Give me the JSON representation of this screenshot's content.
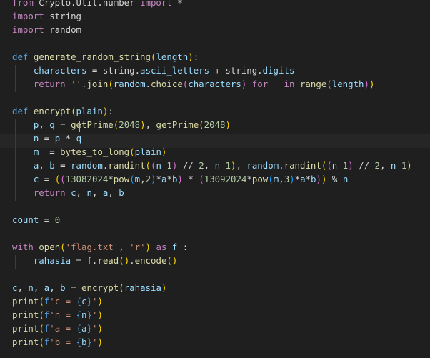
{
  "editor": {
    "language": "python",
    "theme_colors": {
      "background": "#1f1f1f",
      "keyword": "#569cd6",
      "control": "#c586c0",
      "function": "#dcdcaa",
      "string": "#ce9178",
      "number": "#b5cea8",
      "variable": "#9cdcfe",
      "default": "#d4d4d4"
    },
    "lines": [
      {
        "tokens": [
          {
            "t": "from",
            "c": "ctl"
          },
          {
            "t": " Crypto.Util.number ",
            "c": "op"
          },
          {
            "t": "import",
            "c": "ctl"
          },
          {
            "t": " *",
            "c": "op"
          }
        ]
      },
      {
        "tokens": [
          {
            "t": "import",
            "c": "ctl"
          },
          {
            "t": " string",
            "c": "op"
          }
        ]
      },
      {
        "tokens": [
          {
            "t": "import",
            "c": "ctl"
          },
          {
            "t": " random",
            "c": "op"
          }
        ]
      },
      {
        "tokens": []
      },
      {
        "tokens": [
          {
            "t": "def",
            "c": "kw"
          },
          {
            "t": " ",
            "c": "op"
          },
          {
            "t": "generate_random_string",
            "c": "fn"
          },
          {
            "t": "(",
            "c": "pr"
          },
          {
            "t": "length",
            "c": "var"
          },
          {
            "t": ")",
            "c": "pr"
          },
          {
            "t": ":",
            "c": "op"
          }
        ]
      },
      {
        "tokens": [
          {
            "t": "    characters",
            "c": "var"
          },
          {
            "t": " = string.",
            "c": "op"
          },
          {
            "t": "ascii_letters",
            "c": "var"
          },
          {
            "t": " + string.",
            "c": "op"
          },
          {
            "t": "digits",
            "c": "var"
          }
        ]
      },
      {
        "tokens": [
          {
            "t": "    ",
            "c": "op"
          },
          {
            "t": "return",
            "c": "ctl"
          },
          {
            "t": " ",
            "c": "op"
          },
          {
            "t": "''",
            "c": "str"
          },
          {
            "t": ".",
            "c": "op"
          },
          {
            "t": "join",
            "c": "fn"
          },
          {
            "t": "(",
            "c": "pr"
          },
          {
            "t": "random",
            "c": "var"
          },
          {
            "t": ".",
            "c": "op"
          },
          {
            "t": "choice",
            "c": "fn"
          },
          {
            "t": "(",
            "c": "pr2"
          },
          {
            "t": "characters",
            "c": "var"
          },
          {
            "t": ")",
            "c": "pr2"
          },
          {
            "t": " ",
            "c": "op"
          },
          {
            "t": "for",
            "c": "ctl"
          },
          {
            "t": " _ ",
            "c": "op"
          },
          {
            "t": "in",
            "c": "ctl"
          },
          {
            "t": " ",
            "c": "op"
          },
          {
            "t": "range",
            "c": "fn"
          },
          {
            "t": "(",
            "c": "pr2"
          },
          {
            "t": "length",
            "c": "var"
          },
          {
            "t": ")",
            "c": "pr2"
          },
          {
            "t": ")",
            "c": "pr"
          }
        ]
      },
      {
        "tokens": []
      },
      {
        "tokens": [
          {
            "t": "def",
            "c": "kw"
          },
          {
            "t": " ",
            "c": "op"
          },
          {
            "t": "encrypt",
            "c": "fn"
          },
          {
            "t": "(",
            "c": "pr"
          },
          {
            "t": "plain",
            "c": "var"
          },
          {
            "t": ")",
            "c": "pr"
          },
          {
            "t": ":",
            "c": "op"
          }
        ]
      },
      {
        "tokens": [
          {
            "t": "    p",
            "c": "var"
          },
          {
            "t": ", ",
            "c": "op"
          },
          {
            "t": "q",
            "c": "var"
          },
          {
            "t": " = ",
            "c": "op"
          },
          {
            "t": "getPrime",
            "c": "fn"
          },
          {
            "t": "(",
            "c": "pr"
          },
          {
            "t": "2048",
            "c": "num"
          },
          {
            "t": ")",
            "c": "pr"
          },
          {
            "t": ", ",
            "c": "op"
          },
          {
            "t": "getPrime",
            "c": "fn"
          },
          {
            "t": "(",
            "c": "pr"
          },
          {
            "t": "2048",
            "c": "num"
          },
          {
            "t": ")",
            "c": "pr"
          }
        ]
      },
      {
        "tokens": [
          {
            "t": "    n",
            "c": "var"
          },
          {
            "t": " = ",
            "c": "op"
          },
          {
            "t": "p",
            "c": "var"
          },
          {
            "t": " * ",
            "c": "op"
          },
          {
            "t": "q",
            "c": "var"
          }
        ]
      },
      {
        "tokens": [
          {
            "t": "    m",
            "c": "var"
          },
          {
            "t": "  = ",
            "c": "op"
          },
          {
            "t": "bytes_to_long",
            "c": "fn"
          },
          {
            "t": "(",
            "c": "pr"
          },
          {
            "t": "plain",
            "c": "var"
          },
          {
            "t": ")",
            "c": "pr"
          }
        ]
      },
      {
        "tokens": [
          {
            "t": "    a",
            "c": "var"
          },
          {
            "t": ", ",
            "c": "op"
          },
          {
            "t": "b",
            "c": "var"
          },
          {
            "t": " = ",
            "c": "op"
          },
          {
            "t": "random",
            "c": "var"
          },
          {
            "t": ".",
            "c": "op"
          },
          {
            "t": "randint",
            "c": "fn"
          },
          {
            "t": "(",
            "c": "pr"
          },
          {
            "t": "(",
            "c": "pr2"
          },
          {
            "t": "n",
            "c": "var"
          },
          {
            "t": "-",
            "c": "op"
          },
          {
            "t": "1",
            "c": "num"
          },
          {
            "t": ")",
            "c": "pr2"
          },
          {
            "t": " // ",
            "c": "op"
          },
          {
            "t": "2",
            "c": "num"
          },
          {
            "t": ", ",
            "c": "op"
          },
          {
            "t": "n",
            "c": "var"
          },
          {
            "t": "-",
            "c": "op"
          },
          {
            "t": "1",
            "c": "num"
          },
          {
            "t": ")",
            "c": "pr"
          },
          {
            "t": ", ",
            "c": "op"
          },
          {
            "t": "random",
            "c": "var"
          },
          {
            "t": ".",
            "c": "op"
          },
          {
            "t": "randint",
            "c": "fn"
          },
          {
            "t": "(",
            "c": "pr"
          },
          {
            "t": "(",
            "c": "pr2"
          },
          {
            "t": "n",
            "c": "var"
          },
          {
            "t": "-",
            "c": "op"
          },
          {
            "t": "1",
            "c": "num"
          },
          {
            "t": ")",
            "c": "pr2"
          },
          {
            "t": " // ",
            "c": "op"
          },
          {
            "t": "2",
            "c": "num"
          },
          {
            "t": ", ",
            "c": "op"
          },
          {
            "t": "n",
            "c": "var"
          },
          {
            "t": "-",
            "c": "op"
          },
          {
            "t": "1",
            "c": "num"
          },
          {
            "t": ")",
            "c": "pr"
          }
        ]
      },
      {
        "tokens": [
          {
            "t": "    c",
            "c": "var"
          },
          {
            "t": " = ",
            "c": "op"
          },
          {
            "t": "(",
            "c": "pr"
          },
          {
            "t": "(",
            "c": "pr2"
          },
          {
            "t": "13082024",
            "c": "num"
          },
          {
            "t": "*",
            "c": "op"
          },
          {
            "t": "pow",
            "c": "fn"
          },
          {
            "t": "(",
            "c": "pr3"
          },
          {
            "t": "m",
            "c": "var"
          },
          {
            "t": ",",
            "c": "op"
          },
          {
            "t": "2",
            "c": "num"
          },
          {
            "t": ")",
            "c": "pr3"
          },
          {
            "t": "*",
            "c": "op"
          },
          {
            "t": "a",
            "c": "var"
          },
          {
            "t": "*",
            "c": "op"
          },
          {
            "t": "b",
            "c": "var"
          },
          {
            "t": ")",
            "c": "pr2"
          },
          {
            "t": " * ",
            "c": "op"
          },
          {
            "t": "(",
            "c": "pr2"
          },
          {
            "t": "13092024",
            "c": "num"
          },
          {
            "t": "*",
            "c": "op"
          },
          {
            "t": "pow",
            "c": "fn"
          },
          {
            "t": "(",
            "c": "pr3"
          },
          {
            "t": "m",
            "c": "var"
          },
          {
            "t": ",",
            "c": "op"
          },
          {
            "t": "3",
            "c": "num"
          },
          {
            "t": ")",
            "c": "pr3"
          },
          {
            "t": "*",
            "c": "op"
          },
          {
            "t": "a",
            "c": "var"
          },
          {
            "t": "*",
            "c": "op"
          },
          {
            "t": "b",
            "c": "var"
          },
          {
            "t": ")",
            "c": "pr2"
          },
          {
            "t": ")",
            "c": "pr"
          },
          {
            "t": " % ",
            "c": "op"
          },
          {
            "t": "n",
            "c": "var"
          }
        ]
      },
      {
        "tokens": [
          {
            "t": "    ",
            "c": "op"
          },
          {
            "t": "return",
            "c": "ctl"
          },
          {
            "t": " ",
            "c": "op"
          },
          {
            "t": "c",
            "c": "var"
          },
          {
            "t": ", ",
            "c": "op"
          },
          {
            "t": "n",
            "c": "var"
          },
          {
            "t": ", ",
            "c": "op"
          },
          {
            "t": "a",
            "c": "var"
          },
          {
            "t": ", ",
            "c": "op"
          },
          {
            "t": "b",
            "c": "var"
          }
        ]
      },
      {
        "tokens": []
      },
      {
        "tokens": [
          {
            "t": "count",
            "c": "var"
          },
          {
            "t": " = ",
            "c": "op"
          },
          {
            "t": "0",
            "c": "num"
          }
        ]
      },
      {
        "tokens": []
      },
      {
        "tokens": [
          {
            "t": "with",
            "c": "ctl"
          },
          {
            "t": " ",
            "c": "op"
          },
          {
            "t": "open",
            "c": "fn"
          },
          {
            "t": "(",
            "c": "pr"
          },
          {
            "t": "'flag.txt'",
            "c": "str"
          },
          {
            "t": ", ",
            "c": "op"
          },
          {
            "t": "'r'",
            "c": "str"
          },
          {
            "t": ")",
            "c": "pr"
          },
          {
            "t": " ",
            "c": "op"
          },
          {
            "t": "as",
            "c": "ctl"
          },
          {
            "t": " ",
            "c": "op"
          },
          {
            "t": "f",
            "c": "var"
          },
          {
            "t": " :",
            "c": "op"
          }
        ]
      },
      {
        "tokens": [
          {
            "t": "    rahasia",
            "c": "var"
          },
          {
            "t": " = ",
            "c": "op"
          },
          {
            "t": "f",
            "c": "var"
          },
          {
            "t": ".",
            "c": "op"
          },
          {
            "t": "read",
            "c": "fn"
          },
          {
            "t": "(",
            "c": "pr"
          },
          {
            "t": ")",
            "c": "pr"
          },
          {
            "t": ".",
            "c": "op"
          },
          {
            "t": "encode",
            "c": "fn"
          },
          {
            "t": "(",
            "c": "pr"
          },
          {
            "t": ")",
            "c": "pr"
          }
        ]
      },
      {
        "tokens": []
      },
      {
        "tokens": [
          {
            "t": "c",
            "c": "var"
          },
          {
            "t": ", ",
            "c": "op"
          },
          {
            "t": "n",
            "c": "var"
          },
          {
            "t": ", ",
            "c": "op"
          },
          {
            "t": "a",
            "c": "var"
          },
          {
            "t": ", ",
            "c": "op"
          },
          {
            "t": "b",
            "c": "var"
          },
          {
            "t": " = ",
            "c": "op"
          },
          {
            "t": "encrypt",
            "c": "fn"
          },
          {
            "t": "(",
            "c": "pr"
          },
          {
            "t": "rahasia",
            "c": "var"
          },
          {
            "t": ")",
            "c": "pr"
          }
        ]
      },
      {
        "tokens": [
          {
            "t": "print",
            "c": "fn"
          },
          {
            "t": "(",
            "c": "pr"
          },
          {
            "t": "f",
            "c": "kw"
          },
          {
            "t": "'c = ",
            "c": "str"
          },
          {
            "t": "{",
            "c": "kw"
          },
          {
            "t": "c",
            "c": "var"
          },
          {
            "t": "}",
            "c": "kw"
          },
          {
            "t": "'",
            "c": "str"
          },
          {
            "t": ")",
            "c": "pr"
          }
        ]
      },
      {
        "tokens": [
          {
            "t": "print",
            "c": "fn"
          },
          {
            "t": "(",
            "c": "pr"
          },
          {
            "t": "f",
            "c": "kw"
          },
          {
            "t": "'n = ",
            "c": "str"
          },
          {
            "t": "{",
            "c": "kw"
          },
          {
            "t": "n",
            "c": "var"
          },
          {
            "t": "}",
            "c": "kw"
          },
          {
            "t": "'",
            "c": "str"
          },
          {
            "t": ")",
            "c": "pr"
          }
        ]
      },
      {
        "tokens": [
          {
            "t": "print",
            "c": "fn"
          },
          {
            "t": "(",
            "c": "pr"
          },
          {
            "t": "f",
            "c": "kw"
          },
          {
            "t": "'a = ",
            "c": "str"
          },
          {
            "t": "{",
            "c": "kw"
          },
          {
            "t": "a",
            "c": "var"
          },
          {
            "t": "}",
            "c": "kw"
          },
          {
            "t": "'",
            "c": "str"
          },
          {
            "t": ")",
            "c": "pr"
          }
        ]
      },
      {
        "tokens": [
          {
            "t": "print",
            "c": "fn"
          },
          {
            "t": "(",
            "c": "pr"
          },
          {
            "t": "f",
            "c": "kw"
          },
          {
            "t": "'b = ",
            "c": "str"
          },
          {
            "t": "{",
            "c": "kw"
          },
          {
            "t": "b",
            "c": "var"
          },
          {
            "t": "}",
            "c": "kw"
          },
          {
            "t": "'",
            "c": "str"
          },
          {
            "t": ")",
            "c": "pr"
          }
        ]
      }
    ]
  }
}
